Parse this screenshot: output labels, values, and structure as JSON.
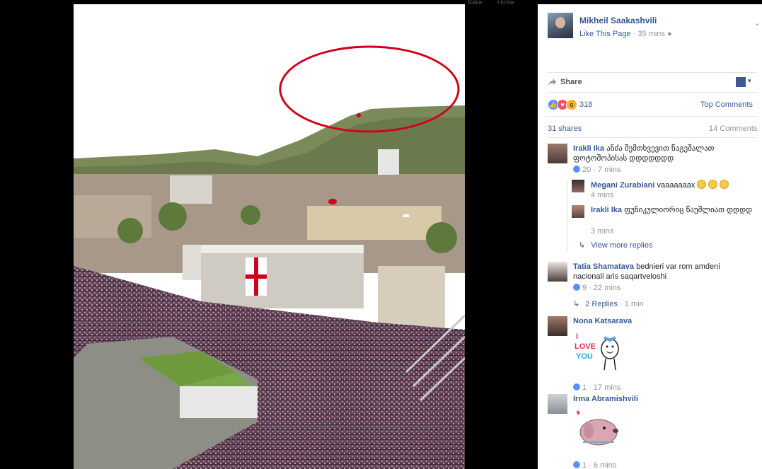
{
  "top_strip": {
    "item1": "Bake",
    "item2": "Home"
  },
  "post": {
    "page_name": "Mikheil Saakashvili",
    "like_link": "Like This Page",
    "separator": "·",
    "time": "35 mins",
    "share_label": "Share",
    "reaction_count": "318",
    "top_comments": "Top Comments",
    "shares": "31 shares",
    "comments_count": "14 Comments"
  },
  "comments": [
    {
      "name": "Irakli Ika",
      "text": "ანძა შემთხვევით წაგეშალათ ფოტოშოპისას დდდდდდდ",
      "likes": "20",
      "time": "7 mins"
    },
    {
      "name": "Megani Zurabiani",
      "text": "vaaaaaaax",
      "time": "4 mins"
    },
    {
      "name": "Irakli Ika",
      "text": "ფუნიკულიორიც წაუშლიათ დდდდ",
      "time": "3 mins"
    },
    {
      "view_more": "View more replies"
    },
    {
      "name": "Tatia Shamatava",
      "text": "bednieri var rom amdeni nacionali aris saqartveloshi",
      "likes": "9",
      "time": "22 mins",
      "replies": "2 Replies",
      "replies_time": "1 min"
    },
    {
      "name": "Nona Katsarava",
      "sticker": "I LOVE YOU",
      "likes": "1",
      "time": "17 mins"
    },
    {
      "name": "Irma Abramishvili",
      "likes": "1",
      "time": "6 mins"
    }
  ],
  "colors": {
    "link": "#365899",
    "muted": "#90949c",
    "annotation": "#d0021b"
  },
  "icons": [
    "share-icon",
    "like-reaction-icon",
    "love-reaction-icon",
    "wow-reaction-icon",
    "reply-arrow-icon",
    "chevron-down-icon"
  ]
}
